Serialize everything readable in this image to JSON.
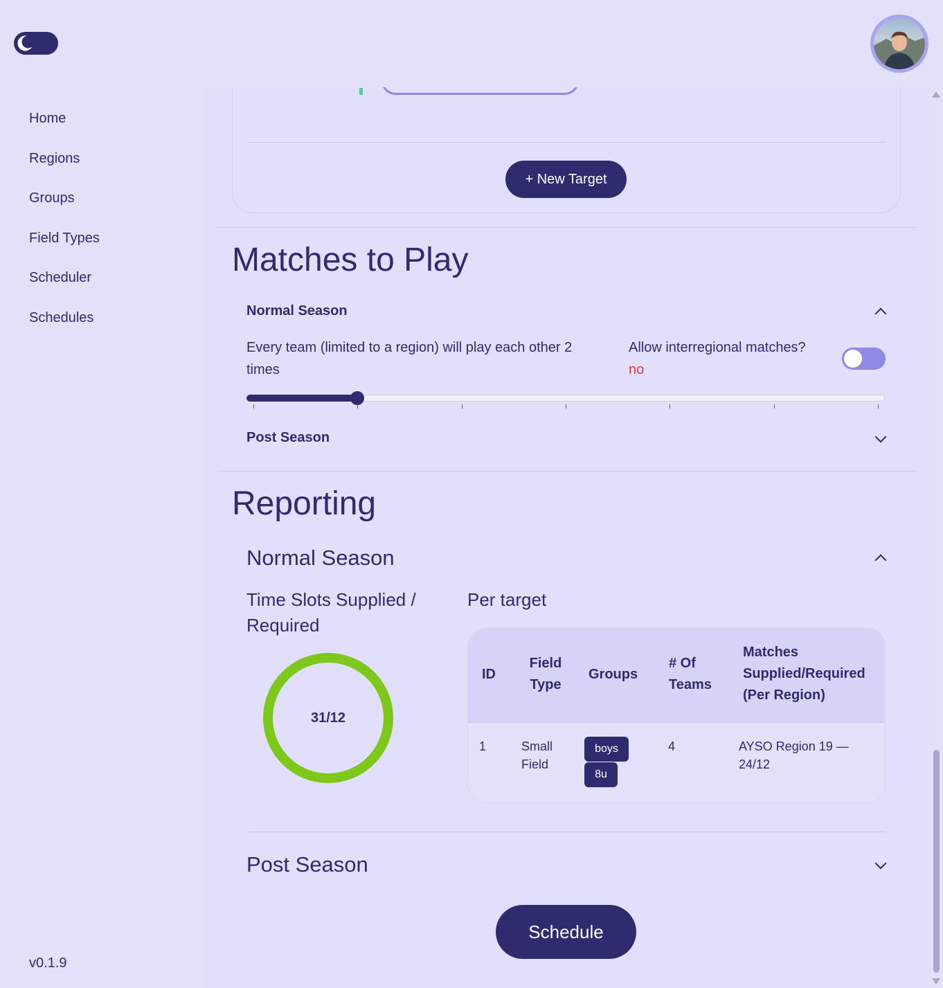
{
  "version": "v0.1.9",
  "sidebar": {
    "items": [
      {
        "label": "Home"
      },
      {
        "label": "Regions"
      },
      {
        "label": "Groups"
      },
      {
        "label": "Field Types"
      },
      {
        "label": "Scheduler"
      },
      {
        "label": "Schedules"
      }
    ]
  },
  "targets": {
    "new_target_label": "+ New Target"
  },
  "matches": {
    "title": "Matches to Play",
    "normal_season": {
      "title": "Normal Season",
      "expanded": true,
      "description": "Every team (limited to a region) will play each other 2 times",
      "interregional_label": "Allow interregional matches?",
      "interregional_value": "no",
      "interregional_enabled": false,
      "slider": {
        "value": 2,
        "min": 1,
        "max": 7,
        "fill_fraction": 0.1667
      }
    },
    "post_season": {
      "title": "Post Season",
      "expanded": false
    }
  },
  "reporting": {
    "title": "Reporting",
    "normal_season": {
      "title": "Normal Season",
      "expanded": true,
      "time_slots_title": "Time Slots Supplied / Required",
      "time_slots_value": "31/12",
      "ring_color": "#7ec81c",
      "per_target_title": "Per target",
      "table": {
        "headers": {
          "id": "ID",
          "field_type": "Field Type",
          "groups": "Groups",
          "teams": "# Of Teams",
          "matches": "Matches Supplied/Required (Per Region)"
        },
        "rows": [
          {
            "id": "1",
            "field_type": "Small Field",
            "groups": [
              "boys",
              "8u"
            ],
            "teams": "4",
            "matches": "AYSO Region 19 — 24/12"
          }
        ]
      }
    },
    "post_season": {
      "title": "Post Season",
      "expanded": false
    }
  },
  "schedule_button_label": "Schedule",
  "colors": {
    "primary": "#2e2c6e",
    "background": "#e3e1fa",
    "accent": "#8e8ae6",
    "success": "#7ec81c",
    "error": "#e53935"
  }
}
